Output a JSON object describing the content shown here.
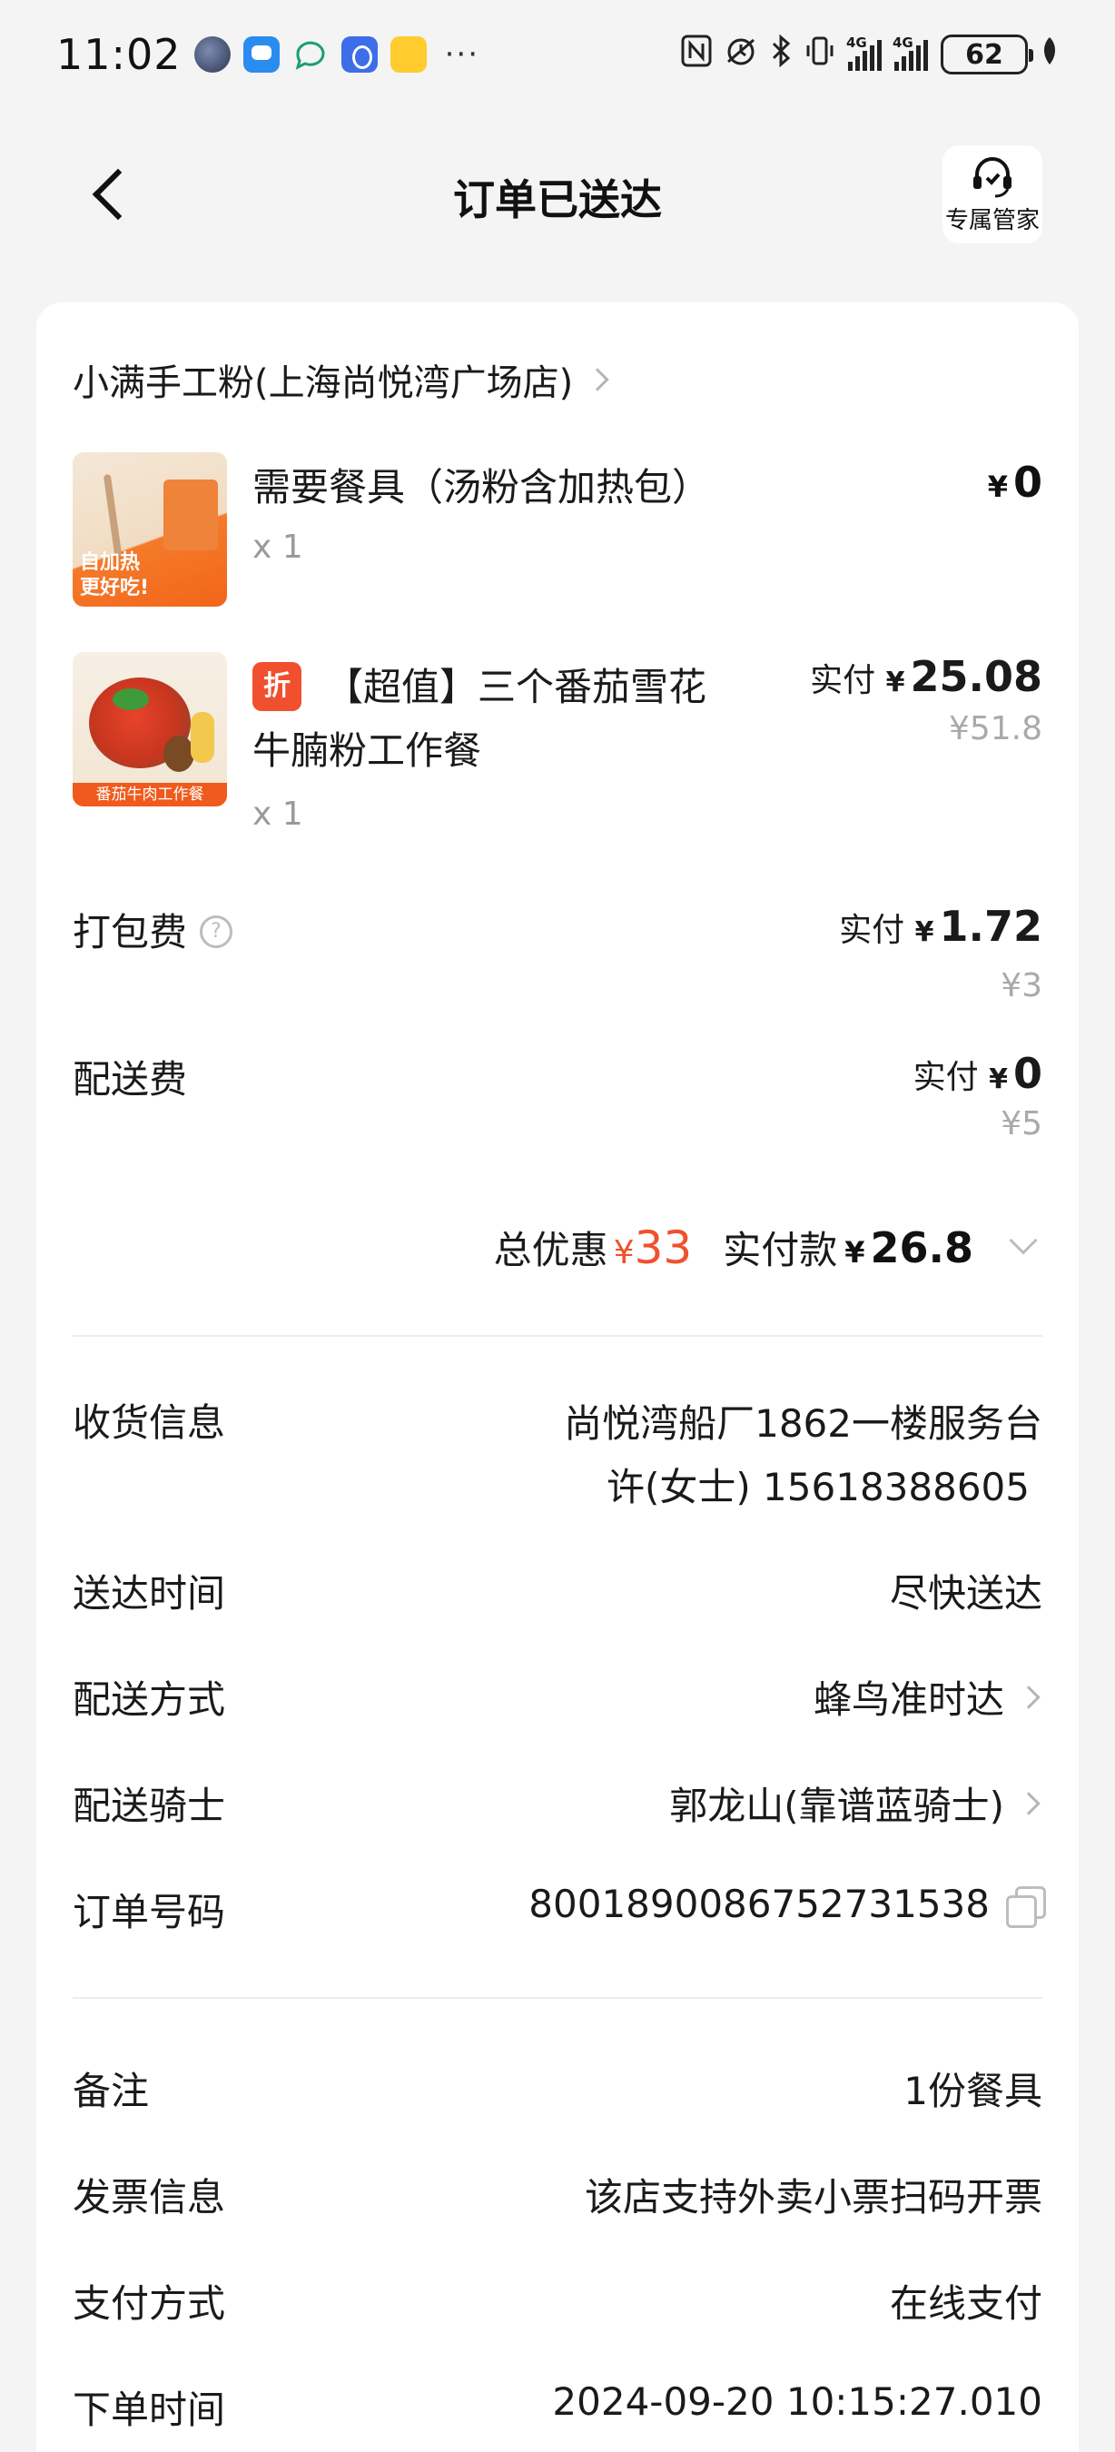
{
  "status_bar": {
    "time": "11:02",
    "more": "···",
    "network_1": "4G",
    "network_2": "4G",
    "battery": "62"
  },
  "header": {
    "title": "订单已送达",
    "butler_label": "专属管家"
  },
  "shop": {
    "name": "小满手工粉(上海尚悦湾广场店)"
  },
  "items": [
    {
      "name": "需要餐具（汤粉含加热包）",
      "qty": "x 1",
      "price": "0",
      "image_tag": "自加热\n更好吃!"
    },
    {
      "badge": "折",
      "name_line1": "【超值】三个番茄雪花",
      "name_line2": "牛腩粉工作餐",
      "qty": "x 1",
      "paid_label": "实付",
      "paid_price": "25.08",
      "original_price": "¥51.8",
      "image_tag": "番茄牛肉工作餐"
    }
  ],
  "fees": {
    "packing": {
      "label": "打包费",
      "paid_label": "实付",
      "paid": "1.72",
      "original": "¥3"
    },
    "delivery": {
      "label": "配送费",
      "paid_label": "实付",
      "paid": "0",
      "original": "¥5"
    }
  },
  "totals": {
    "discount_label": "总优惠",
    "discount_value": "33",
    "paid_label": "实付款",
    "paid_value": "26.8"
  },
  "delivery_info": {
    "address_label": "收货信息",
    "address_line1": "尚悦湾船厂1862一楼服务台",
    "address_line2": "许(女士) 15618388605",
    "time_label": "送达时间",
    "time_value": "尽快送达",
    "method_label": "配送方式",
    "method_value": "蜂鸟准时达",
    "rider_label": "配送骑士",
    "rider_value": "郭龙山(靠谱蓝骑士)",
    "order_no_label": "订单号码",
    "order_no_value": "8001890086752731538"
  },
  "order_info": {
    "remark_label": "备注",
    "remark_value": "1份餐具",
    "invoice_label": "发票信息",
    "invoice_value": "该店支持外卖小票扫码开票",
    "payment_label": "支付方式",
    "payment_value": "在线支付",
    "order_time_label": "下单时间",
    "order_time_value": "2024-09-20 10:15:27.010"
  },
  "icons": {
    "back": "back-arrow-icon",
    "butler": "headset-icon",
    "help": "question-circle-icon",
    "copy": "copy-icon",
    "chevron": "chevron-right-icon",
    "expand": "chevron-down-icon"
  },
  "colors": {
    "accent": "#f0502e",
    "background": "#f4f4f4",
    "card": "#ffffff",
    "muted": "#9a9a9a"
  }
}
